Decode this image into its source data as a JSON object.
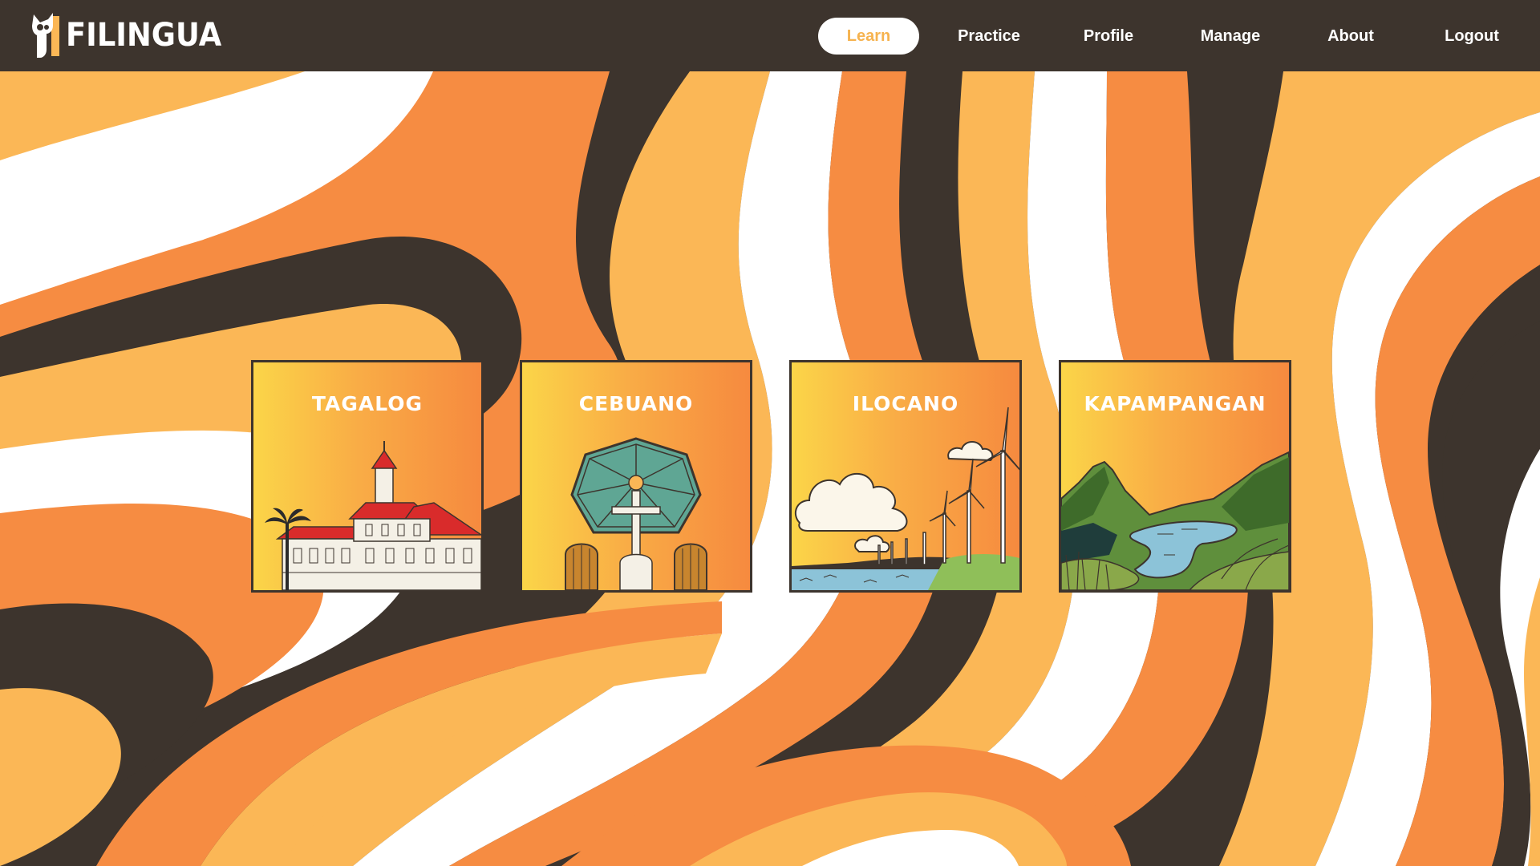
{
  "app": {
    "logo_text": "FILINGUA"
  },
  "nav": {
    "items": [
      {
        "label": "Learn",
        "active": true
      },
      {
        "label": "Practice",
        "active": false
      },
      {
        "label": "Profile",
        "active": false
      },
      {
        "label": "Manage",
        "active": false
      },
      {
        "label": "About",
        "active": false
      },
      {
        "label": "Logout",
        "active": false
      }
    ]
  },
  "languages": [
    {
      "name": "TAGALOG",
      "illustration": "heritage-mansion-illustration"
    },
    {
      "name": "CEBUANO",
      "illustration": "magellans-cross-kiosk-illustration"
    },
    {
      "name": "ILOCANO",
      "illustration": "windmill-seaside-illustration"
    },
    {
      "name": "KAPAMPANGAN",
      "illustration": "mountain-crater-lake-illustration"
    }
  ],
  "colors": {
    "dark_brown": "#3d342d",
    "orange": "#f68c42",
    "light_orange": "#fbb756",
    "white": "#ffffff",
    "active_text": "#f6b34f"
  }
}
